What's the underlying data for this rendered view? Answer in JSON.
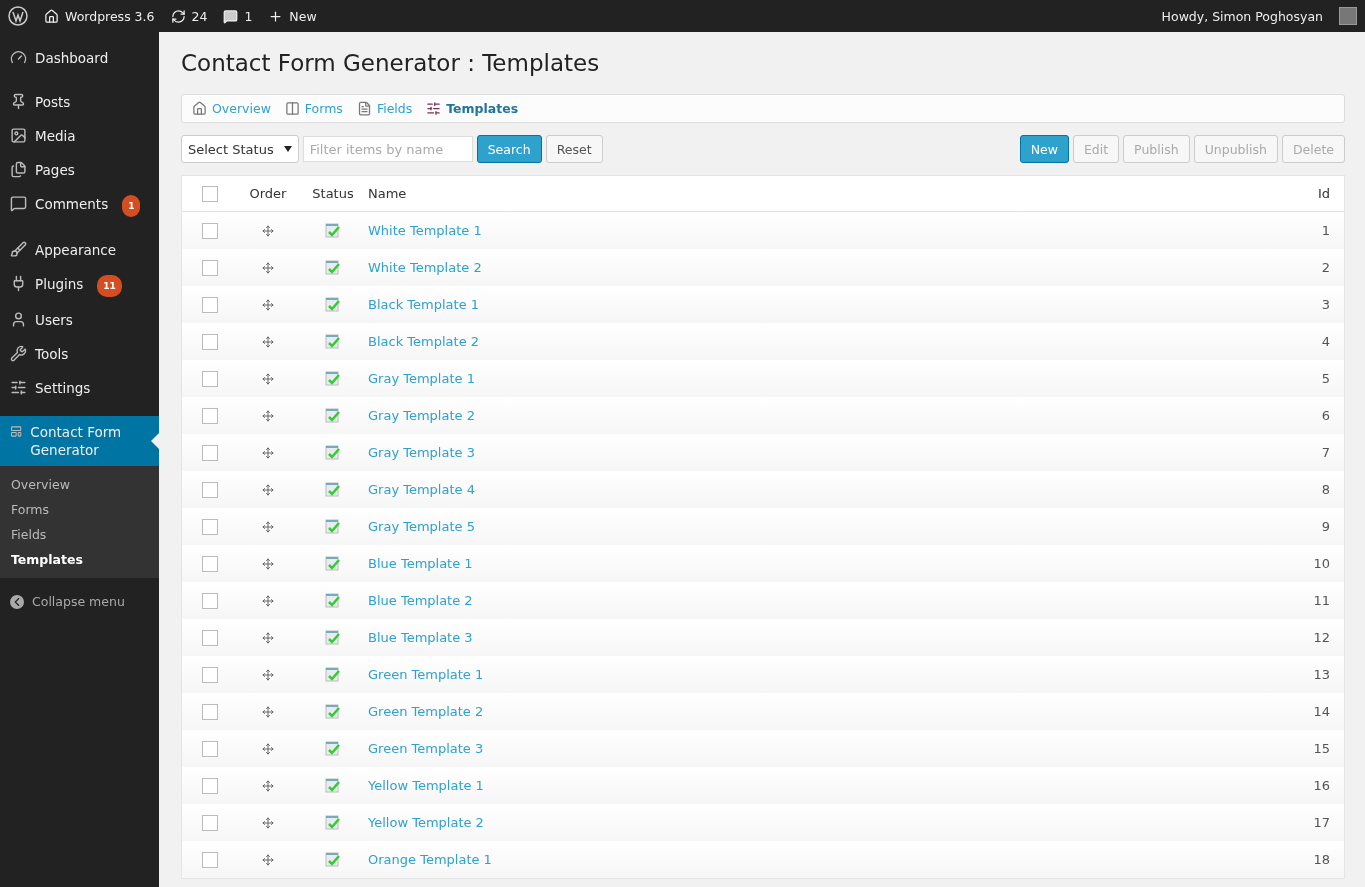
{
  "admin_bar": {
    "site": "Wordpress 3.6",
    "updates": "24",
    "comments": "1",
    "new": "New",
    "greeting": "Howdy, Simon Poghosyan"
  },
  "sidebar": {
    "groups": [
      [
        {
          "label": "Dashboard",
          "selected": false
        }
      ],
      [
        {
          "label": "Posts",
          "selected": false
        },
        {
          "label": "Media",
          "selected": false
        },
        {
          "label": "Pages",
          "selected": false
        },
        {
          "label": "Comments",
          "badge": "1",
          "selected": false
        }
      ],
      [
        {
          "label": "Appearance",
          "selected": false
        },
        {
          "label": "Plugins",
          "badge": "11",
          "selected": false
        },
        {
          "label": "Users",
          "selected": false
        },
        {
          "label": "Tools",
          "selected": false
        },
        {
          "label": "Settings",
          "selected": false
        }
      ],
      [
        {
          "label": "Contact Form Generator",
          "selected": true,
          "children": [
            {
              "label": "Overview",
              "selected": false
            },
            {
              "label": "Forms",
              "selected": false
            },
            {
              "label": "Fields",
              "selected": false
            },
            {
              "label": "Templates",
              "selected": true
            }
          ]
        }
      ]
    ],
    "collapse": "Collapse menu"
  },
  "page_title": "Contact Form Generator : Templates",
  "tabs": [
    {
      "label": "Overview",
      "selected": false
    },
    {
      "label": "Forms",
      "selected": false
    },
    {
      "label": "Fields",
      "selected": false
    },
    {
      "label": "Templates",
      "selected": true
    }
  ],
  "filter": {
    "status_select": "Select Status",
    "search": {
      "placeholder": "Filter items by name"
    },
    "search_button": "Search",
    "reset_button": "Reset"
  },
  "actions": [
    {
      "label": "New",
      "primary": true,
      "disabled": false
    },
    {
      "label": "Edit",
      "primary": false,
      "disabled": true
    },
    {
      "label": "Publish",
      "primary": false,
      "disabled": true
    },
    {
      "label": "Unpublish",
      "primary": false,
      "disabled": true
    },
    {
      "label": "Delete",
      "primary": false,
      "disabled": true
    }
  ],
  "table": {
    "select_all": {
      "checked": false
    },
    "columns": [
      "Order",
      "Status",
      "Name",
      "Id"
    ],
    "rows": [
      {
        "checked": false,
        "published": true,
        "name": "White Template 1",
        "id": "1"
      },
      {
        "checked": false,
        "published": true,
        "name": "White Template 2",
        "id": "2"
      },
      {
        "checked": false,
        "published": true,
        "name": "Black Template 1",
        "id": "3"
      },
      {
        "checked": false,
        "published": true,
        "name": "Black Template 2",
        "id": "4"
      },
      {
        "checked": false,
        "published": true,
        "name": "Gray Template 1",
        "id": "5"
      },
      {
        "checked": false,
        "published": true,
        "name": "Gray Template 2",
        "id": "6"
      },
      {
        "checked": false,
        "published": true,
        "name": "Gray Template 3",
        "id": "7"
      },
      {
        "checked": false,
        "published": true,
        "name": "Gray Template 4",
        "id": "8"
      },
      {
        "checked": false,
        "published": true,
        "name": "Gray Template 5",
        "id": "9"
      },
      {
        "checked": false,
        "published": true,
        "name": "Blue Template 1",
        "id": "10"
      },
      {
        "checked": false,
        "published": true,
        "name": "Blue Template 2",
        "id": "11"
      },
      {
        "checked": false,
        "published": true,
        "name": "Blue Template 3",
        "id": "12"
      },
      {
        "checked": false,
        "published": true,
        "name": "Green Template 1",
        "id": "13"
      },
      {
        "checked": false,
        "published": true,
        "name": "Green Template 2",
        "id": "14"
      },
      {
        "checked": false,
        "published": true,
        "name": "Green Template 3",
        "id": "15"
      },
      {
        "checked": false,
        "published": true,
        "name": "Yellow Template 1",
        "id": "16"
      },
      {
        "checked": false,
        "published": true,
        "name": "Yellow Template 2",
        "id": "17"
      },
      {
        "checked": false,
        "published": true,
        "name": "Orange Template 1",
        "id": "18"
      }
    ]
  }
}
